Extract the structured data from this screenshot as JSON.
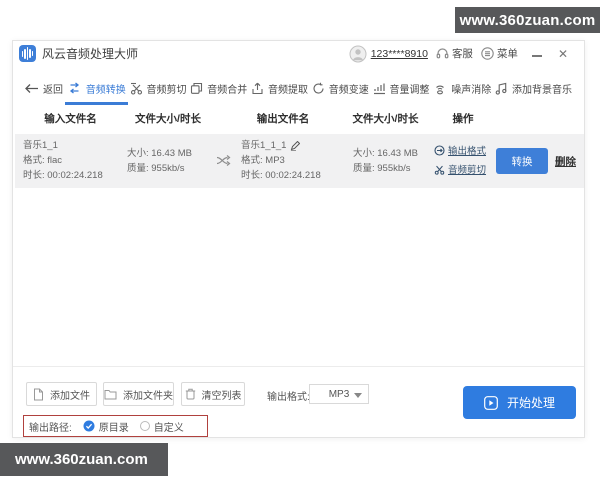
{
  "watermarks": {
    "top": "www.360zuan.com",
    "bottom": "www.360zuan.com"
  },
  "titlebar": {
    "app_name": "风云音频处理大师",
    "account": "123****8910",
    "support_label": "客服",
    "menu_label": "菜单",
    "close_label": "✕"
  },
  "toolbar": {
    "back_label": "返回",
    "items": [
      {
        "label": "音频转换",
        "icon": "swap-icon",
        "active": true
      },
      {
        "label": "音频剪切",
        "icon": "scissors-icon"
      },
      {
        "label": "音频合并",
        "icon": "merge-icon"
      },
      {
        "label": "音频提取",
        "icon": "extract-icon"
      },
      {
        "label": "音频变速",
        "icon": "speed-icon"
      },
      {
        "label": "音量调整",
        "icon": "volume-icon"
      },
      {
        "label": "噪声消除",
        "icon": "noise-icon"
      },
      {
        "label": "添加背景音乐",
        "icon": "music-icon"
      }
    ]
  },
  "table": {
    "headers": [
      "输入文件名",
      "文件大小/时长",
      "输出文件名",
      "文件大小/时长",
      "操作"
    ],
    "row": {
      "input_name": "音乐1_1",
      "input_format": "格式: flac",
      "input_duration": "时长: 00:02:24.218",
      "input_size": "大小: 16.43 MB",
      "input_quality": "质量: 955kb/s",
      "output_name": "音乐1_1_1",
      "output_format": "格式: MP3",
      "output_duration": "时长: 00:02:24.218",
      "output_size": "大小: 16.43 MB",
      "output_quality": "质量: 955kb/s",
      "op_output_format": "输出格式",
      "op_audio_cut": "音频剪切",
      "convert_label": "转换",
      "delete_label": "删除"
    }
  },
  "footer": {
    "add_file": "添加文件",
    "add_folder": "添加文件夹",
    "clear_list": "清空列表",
    "output_format_label": "输出格式:",
    "format_value": "MP3",
    "start_label": "开始处理",
    "output_path_label": "输出路径:",
    "radio_original": "原目录",
    "radio_custom": "自定义"
  },
  "colors": {
    "accent": "#3e7fd8",
    "banner": "#57585a",
    "highlight_box": "#b0413e"
  }
}
